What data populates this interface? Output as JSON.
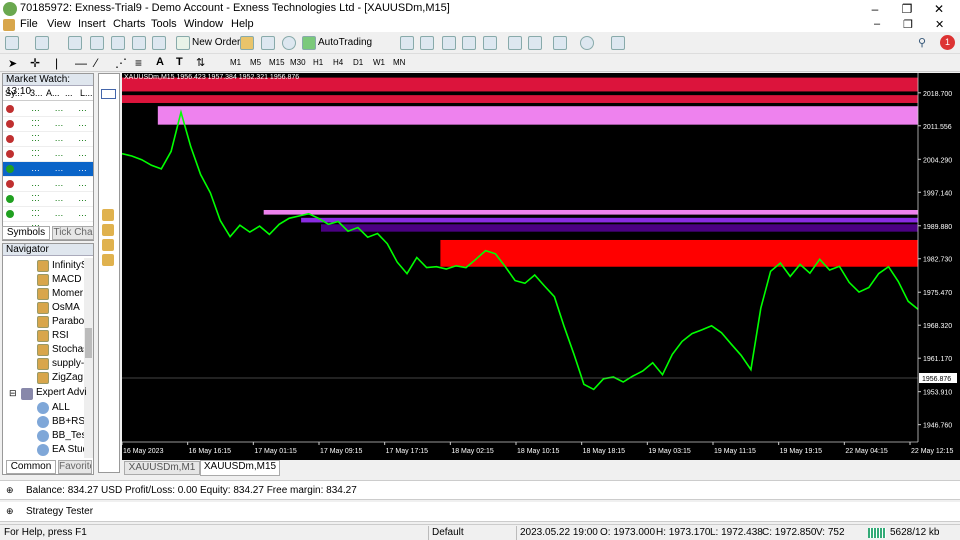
{
  "window": {
    "title": "70185972: Exness-Trial9 - Demo Account - Exness Technologies Ltd - [XAUUSDm,M15]",
    "minimize": "–",
    "restore": "❐",
    "close": "✕",
    "inner_minimize": "–",
    "inner_restore": "❐",
    "inner_close": "✕"
  },
  "menu": [
    "File",
    "View",
    "Insert",
    "Charts",
    "Tools",
    "Window",
    "Help"
  ],
  "toolbar": {
    "new_order": "New Order",
    "autotrading": "AutoTrading",
    "notification_count": "1"
  },
  "timeframes": [
    "M1",
    "M5",
    "M15",
    "M30",
    "H1",
    "H4",
    "D1",
    "W1",
    "MN"
  ],
  "market_watch": {
    "title": "Market Watch: 13:10",
    "columns": [
      "Sy...",
      "3...",
      "A...",
      "...",
      "L..."
    ],
    "row_count": 8,
    "row_colors": [
      "#c03030",
      "#c03030",
      "#c03030",
      "#c03030",
      "#20a020",
      "#c03030",
      "#20a020",
      "#20a020"
    ],
    "tabs": [
      "Symbols",
      "Tick Cha"
    ]
  },
  "navigator": {
    "title": "Navigator",
    "items": [
      "InfinityS",
      "MACD",
      "Momer",
      "OsMA",
      "Parabol",
      "RSI",
      "Stochas",
      "supply-",
      "ZigZag"
    ],
    "expert_title": "Expert Advi",
    "experts": [
      "ALL",
      "BB+RSI",
      "BB_Test",
      "EA Stud"
    ],
    "tabs": [
      "Common",
      "Favorite"
    ]
  },
  "chart": {
    "header": "XAUUSDm,M15  1956.423 1957.384 1952.321 1956.876",
    "current_price": "1956.876",
    "price_labels": [
      "2018.700",
      "2011.556",
      "2004.290",
      "1997.140",
      "1989.880",
      "1982.730",
      "1975.470",
      "1968.320",
      "1961.170",
      "1953.910",
      "1946.760"
    ],
    "price_range": [
      1943.0,
      2023.0
    ],
    "time_labels": [
      "16 May 2023",
      "16 May 16:15",
      "17 May 01:15",
      "17 May 09:15",
      "17 May 17:15",
      "18 May 02:15",
      "18 May 10:15",
      "18 May 18:15",
      "19 May 03:15",
      "19 May 11:15",
      "19 May 19:15",
      "22 May 04:15",
      "22 May 12:15"
    ],
    "zones": [
      {
        "from": 2019.0,
        "to": 2022.0,
        "color": "#dc143c",
        "start": 0.0
      },
      {
        "from": 2016.5,
        "to": 2018.2,
        "color": "#dc143c",
        "start": 0.0
      },
      {
        "from": 2011.8,
        "to": 2015.8,
        "color": "#ee82ee",
        "start": 0.045
      },
      {
        "from": 1992.3,
        "to": 1993.3,
        "color": "#ee82ee",
        "start": 0.178
      },
      {
        "from": 1990.6,
        "to": 1991.6,
        "color": "#8a2be2",
        "start": 0.225
      },
      {
        "from": 1988.6,
        "to": 1990.2,
        "color": "#4b0082",
        "start": 0.25
      },
      {
        "from": 1981.0,
        "to": 1986.8,
        "color": "#ff0000",
        "start": 0.4
      }
    ],
    "series_color": "#00ff00",
    "price_path": [
      2005.5,
      2005.0,
      2004.2,
      2003.0,
      2002.2,
      2006.0,
      2014.5,
      2007.0,
      2001.0,
      1997.0,
      1991.0,
      1987.5,
      1990.0,
      1988.5,
      1989.8,
      1988.0,
      1990.2,
      1991.5,
      1992.0,
      1992.5,
      1991.5,
      1990.2,
      1990.8,
      1988.7,
      1989.5,
      1987.4,
      1988.2,
      1986.0,
      1982.0,
      1979.5,
      1983.0,
      1980.8,
      1981.0,
      1980.5,
      1981.2,
      1980.8,
      1982.6,
      1984.5,
      1983.8,
      1981.0,
      1978.0,
      1977.4,
      1979.2,
      1976.8,
      1974.5,
      1968.0,
      1962.0,
      1955.5,
      1954.4,
      1956.7,
      1957.1,
      1956.0,
      1957.3,
      1958.4,
      1960.2,
      1957.6,
      1962.0,
      1964.8,
      1966.5,
      1967.3,
      1968.2,
      1966.7,
      1964.2,
      1961.8,
      1958.7,
      1972.0,
      1980.0,
      1981.8,
      1978.9,
      1981.5,
      1979.6,
      1982.6,
      1980.3,
      1981.1,
      1977.6,
      1975.5,
      1976.5,
      1979.5,
      1981.0,
      1977.8,
      1973.5,
      1971.8
    ]
  },
  "chart_tabs": [
    "XAUUSDm,M1",
    "XAUUSDm,M15"
  ],
  "terminal": {
    "balance_line": "Balance: 834.27 USD  Profit/Loss: 0.00  Equity: 834.27  Free margin: 834.27",
    "strategy_tester": "Strategy Tester"
  },
  "status": {
    "help": "For Help, press F1",
    "profile": "Default",
    "datetime": "2023.05.22 19:00",
    "open": "O: 1973.000",
    "high": "H: 1973.170",
    "low": "L: 1972.438",
    "close": "C: 1972.850",
    "volume": "V: 752",
    "traffic": "5628/12 kb"
  }
}
